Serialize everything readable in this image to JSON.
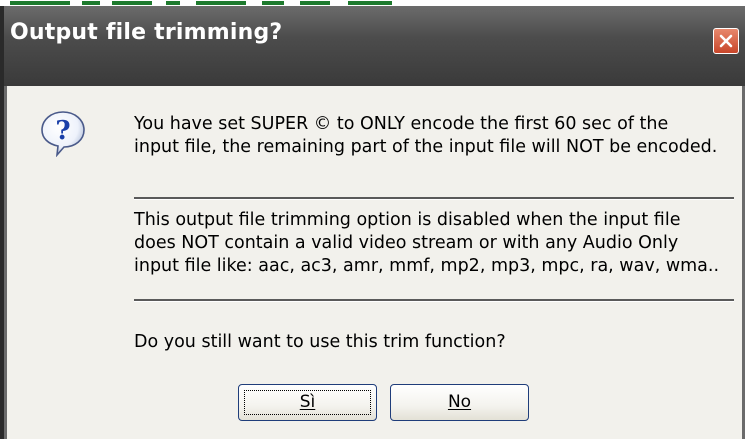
{
  "dialog": {
    "title": "Output file trimming?",
    "message_line1": "You have set SUPER © to ONLY encode the first 60 sec of the",
    "message_line2": "input file, the remaining part of the input file will NOT be encoded.",
    "note_line1": "This output file trimming option is disabled when the input file",
    "note_line2": "does NOT contain a valid video stream or with any Audio Only",
    "note_line3": "input file like: aac, ac3, amr, mmf, mp2, mp3, mpc, ra, wav, wma..",
    "question": "Do you still want to use this trim function?",
    "yes_label": "Sì",
    "no_label": "No"
  },
  "colors": {
    "titlebar": "#4c4c4c",
    "close_button": "#c8462a",
    "dialog_background": "#f2f1ec",
    "button_border": "#1f3d7a"
  },
  "icons": {
    "question": "question-icon",
    "close": "close-icon"
  }
}
